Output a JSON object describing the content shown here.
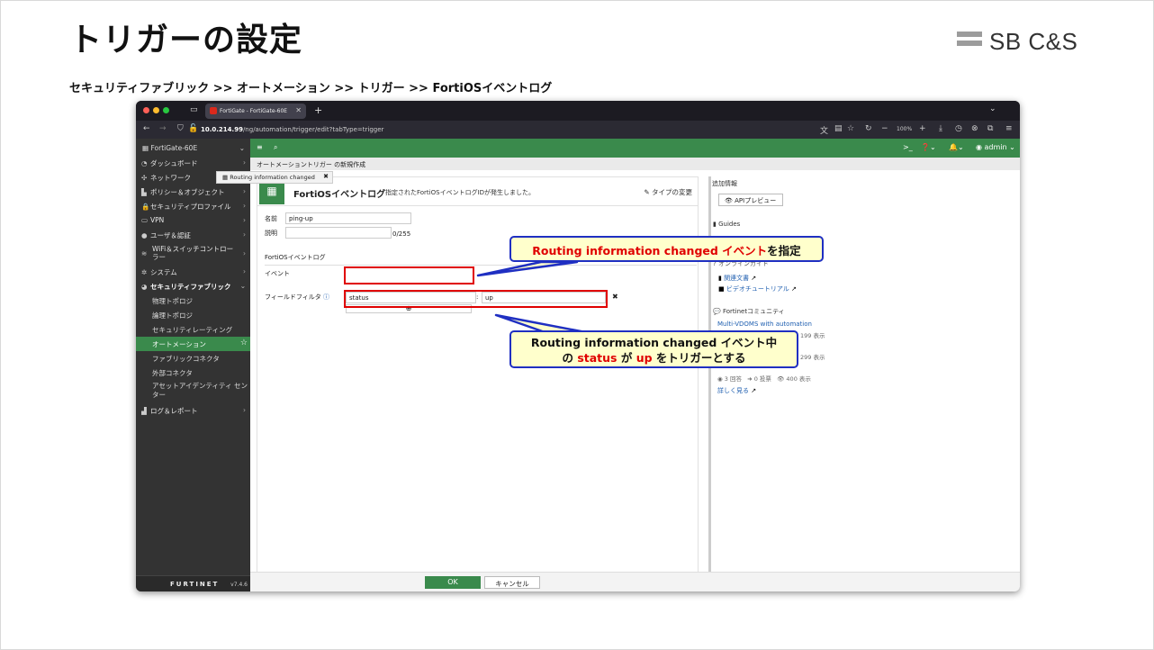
{
  "slide": {
    "title": "トリガーの設定",
    "logo_text": "SB C&S",
    "breadcrumb": "セキュリティファブリック >> オートメーション >> トリガー >> FortiOSイベントログ"
  },
  "browser": {
    "tab_title": "FortiGate - FortiGate-60E",
    "url_host": "10.0.214.99",
    "url_path": "/ng/automation/trigger/edit?tabType=trigger",
    "zoom": "100%"
  },
  "sidebar": {
    "device": "FortiGate-60E",
    "items": [
      {
        "label": "ダッシュボード"
      },
      {
        "label": "ネットワーク"
      },
      {
        "label": "ポリシー＆オブジェクト"
      },
      {
        "label": "セキュリティプロファイル"
      },
      {
        "label": "VPN"
      },
      {
        "label": "ユーザ＆認証"
      },
      {
        "label": "WiFi＆スイッチコントロー ラー"
      },
      {
        "label": "システム"
      },
      {
        "label": "セキュリティファブリック"
      }
    ],
    "subitems": [
      {
        "label": "物理トポロジ"
      },
      {
        "label": "論理トポロジ"
      },
      {
        "label": "セキュリティレーティング"
      },
      {
        "label": "オートメーション"
      },
      {
        "label": "ファブリックコネクタ"
      },
      {
        "label": "外部コネクタ"
      },
      {
        "label": "アセットアイデンティティ センター"
      }
    ],
    "log_item": "ログ＆レポート",
    "brand": "FURTINET",
    "version": "v7.4.6"
  },
  "topbar": {
    "user": "admin"
  },
  "page": {
    "subheader": "オートメーショントリガー の新規作成",
    "panel_title": "FortiOSイベントログ",
    "panel_desc": "指定されたFortiOSイベントログIDが発生しました。",
    "change_type": "タイプの変更",
    "name_label": "名前",
    "name_value": "ping-up",
    "desc_label": "説明",
    "desc_counter": "0/255",
    "section_label": "FortiOSイベントログ",
    "event_label": "イベント",
    "event_value": "Routing information changed",
    "filter_label": "フィールドフィルタ",
    "filter_field": "status",
    "filter_value": "up",
    "ok_label": "OK",
    "cancel_label": "キャンセル"
  },
  "rightcol": {
    "extra_info": "追加情報",
    "api_preview": "APIプレビュー",
    "guides": "Guides",
    "online_guide": "オンラインガイド",
    "related_docs": "関連文書",
    "video_tutorial": "ビデオチュートリアル",
    "community": "Fortinetコミュニティ",
    "community_link": "Multi-VDOMS with automation",
    "views_1": "199 表示",
    "views_2": "299 表示",
    "answers": "3 回答",
    "votes": "0 投票",
    "views_3": "400 表示",
    "more": "詳しく見る"
  },
  "callouts": {
    "c1_red": "Routing information changed イベント",
    "c1_rest": "を指定",
    "c2_line1": "Routing information changed イベント中",
    "c2_pre": "の ",
    "c2_status": "status",
    "c2_ga": " が ",
    "c2_up": "up",
    "c2_post": " をトリガーとする"
  }
}
